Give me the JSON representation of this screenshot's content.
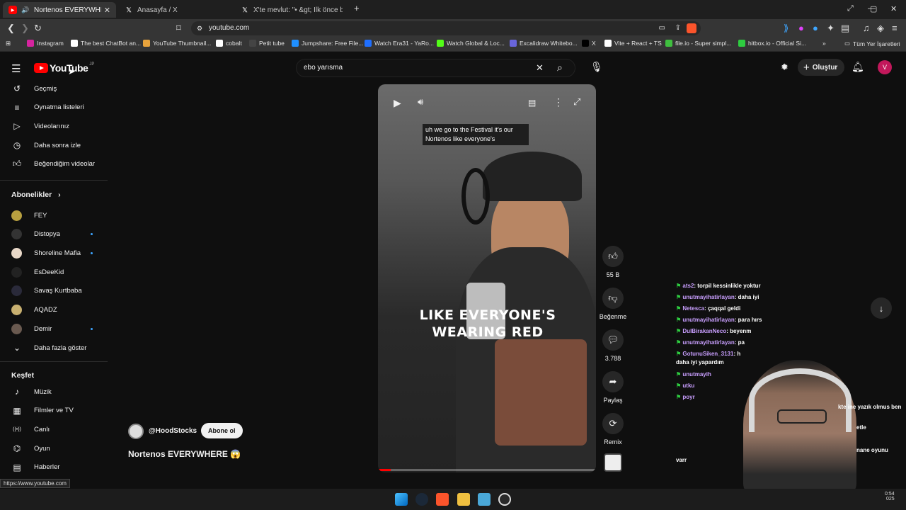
{
  "browser": {
    "tabs": [
      {
        "title": "Nortenos EVERYWHERE 😱 -",
        "active": true
      },
      {
        "title": "Anasayfa / X",
        "active": false
      },
      {
        "title": "X'te mevlut: \"• &gt; İlk önce birbirleri",
        "active": false
      }
    ],
    "new_tab": "+",
    "url": "youtube.com",
    "bookmarks": [
      {
        "label": "Instagram",
        "color": "#d6249f"
      },
      {
        "label": "The best ChatBot an...",
        "color": "#ffffff"
      },
      {
        "label": "YouTube Thumbnail...",
        "color": "#e8a33c"
      },
      {
        "label": "cobalt",
        "color": "#ffffff"
      },
      {
        "label": "Petit tube",
        "color": "#444444"
      },
      {
        "label": "Jumpshare: Free File...",
        "color": "#1f8fff"
      },
      {
        "label": "Watch Era31 - YaRo...",
        "color": "#1f6fff"
      },
      {
        "label": "Watch Global & Loc...",
        "color": "#53fc18"
      },
      {
        "label": "Excalidraw Whitebo...",
        "color": "#6965db"
      },
      {
        "label": "X",
        "color": "#000000"
      },
      {
        "label": "Vite + React + TS",
        "color": "#ffffff"
      },
      {
        "label": "file.io - Super simpl...",
        "color": "#3fbf3f"
      },
      {
        "label": "hitbox.io - Official Si...",
        "color": "#2ecc40"
      }
    ],
    "all_bookmarks": "Tüm Yer İşaretleri"
  },
  "youtube": {
    "logo_text": "YouTube",
    "logo_region": "JP",
    "search_query": "ebo yarısma",
    "create_label": "Oluştur",
    "avatar_letter": "V",
    "sidebar": {
      "you_items": [
        {
          "label": "Geçmiş",
          "icon": "history-icon"
        },
        {
          "label": "Oynatma listeleri",
          "icon": "playlist-icon"
        },
        {
          "label": "Videolarınız",
          "icon": "your-videos-icon"
        },
        {
          "label": "Daha sonra izle",
          "icon": "watch-later-icon"
        },
        {
          "label": "Beğendiğim videolar",
          "icon": "liked-icon"
        }
      ],
      "subscriptions_title": "Abonelikler",
      "subscriptions": [
        {
          "label": "FEY",
          "new": false,
          "color": "#b8a040"
        },
        {
          "label": "Distopya",
          "new": true,
          "color": "#333333"
        },
        {
          "label": "Shoreline Mafia",
          "new": true,
          "color": "#e8d8c8"
        },
        {
          "label": "EsDeeKid",
          "new": false,
          "color": "#222222"
        },
        {
          "label": "Savaş Kurtbaba",
          "new": false,
          "color": "#2a2a3a"
        },
        {
          "label": "AQADZ",
          "new": false,
          "color": "#c8b070"
        },
        {
          "label": "Demir",
          "new": true,
          "color": "#6a5a50"
        }
      ],
      "show_more": "Daha fazla göster",
      "explore_title": "Keşfet",
      "explore_items": [
        {
          "label": "Müzik",
          "icon": "music-icon"
        },
        {
          "label": "Filmler ve TV",
          "icon": "film-icon"
        },
        {
          "label": "Canlı",
          "icon": "live-icon"
        },
        {
          "label": "Oyun",
          "icon": "gaming-icon"
        },
        {
          "label": "Haberler",
          "icon": "news-icon"
        }
      ]
    },
    "short": {
      "caption": "uh we go to the Festival it's our Nortenos like everyone's",
      "overlay_line1": "LIKE EVERYONE'S",
      "overlay_line2": "WEARING RED",
      "channel": "@HoodStocks",
      "subscribe_label": "Abone ol",
      "title": "Nortenos EVERYWHERE 😱",
      "likes": "55 B",
      "dislike_label": "Beğenme",
      "comments": "3.788",
      "share_label": "Paylaş",
      "remix_label": "Remix",
      "progress": 0.06
    }
  },
  "stream_chat": [
    {
      "user": "ats2",
      "msg": ": torpil kessinlikle yoktur"
    },
    {
      "user": "unutmayihatirlayan",
      "msg": ": daha iyi"
    },
    {
      "user": "Netesca",
      "msg": ": çaqqal geldi"
    },
    {
      "user": "unutmayihatirlayan",
      "msg": ": para hırs"
    },
    {
      "user": "DulBirakanNeco",
      "msg": ": beyenm"
    },
    {
      "user": "unutmayihatirlayan",
      "msg": ": pa"
    },
    {
      "user": "GotunuSiken_3131",
      "msg": ": h"
    },
    {
      "user": "",
      "msg": "daha iyi yapardım"
    },
    {
      "user": "unutmayih",
      "msg": ""
    },
    {
      "user": "utku",
      "msg": ""
    },
    {
      "user": "poyr",
      "msg": ""
    }
  ],
  "chat_side_text": {
    "line1": "kte ine yazık olmus ben",
    "line2": "etle",
    "line3": "nane oyunu",
    "line4": "varr"
  },
  "status_url": "https://www.youtube.com",
  "clock": {
    "time": "0:54",
    "date": "025"
  }
}
